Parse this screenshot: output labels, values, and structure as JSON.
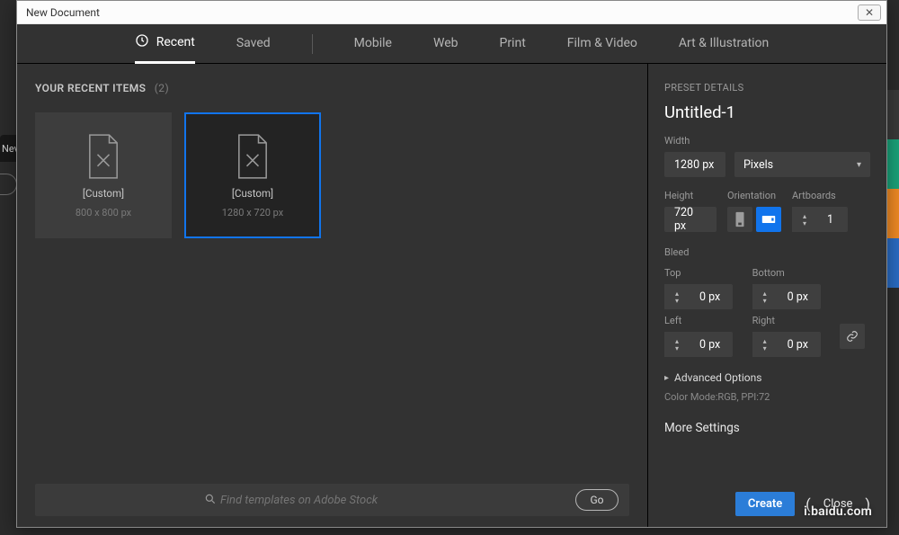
{
  "window": {
    "title": "New Document",
    "close_x": "✕"
  },
  "tabs": {
    "recent": "Recent",
    "saved": "Saved",
    "mobile": "Mobile",
    "web": "Web",
    "print": "Print",
    "film": "Film & Video",
    "art": "Art & Illustration"
  },
  "recent_header": {
    "label": "YOUR RECENT ITEMS",
    "count": "(2)"
  },
  "thumbs": [
    {
      "title": "[Custom]",
      "dims": "800 x 800 px"
    },
    {
      "title": "[Custom]",
      "dims": "1280 x 720 px"
    }
  ],
  "stock": {
    "placeholder": "Find templates on Adobe Stock",
    "go": "Go"
  },
  "preset": {
    "section": "PRESET DETAILS",
    "docname": "Untitled-1",
    "width_label": "Width",
    "width_value": "1280 px",
    "units": "Pixels",
    "height_label": "Height",
    "height_value": "720 px",
    "orientation_label": "Orientation",
    "artboards_label": "Artboards",
    "artboards_value": "1",
    "bleed_label": "Bleed",
    "top": "Top",
    "bottom": "Bottom",
    "left": "Left",
    "right": "Right",
    "zero": "0 px",
    "advanced": "Advanced Options",
    "color_mode": "Color Mode:RGB, PPI:72",
    "more": "More Settings"
  },
  "footer": {
    "create": "Create",
    "close": "Close"
  },
  "bg_tab": "Nev",
  "watermark": "i.baidu.com"
}
